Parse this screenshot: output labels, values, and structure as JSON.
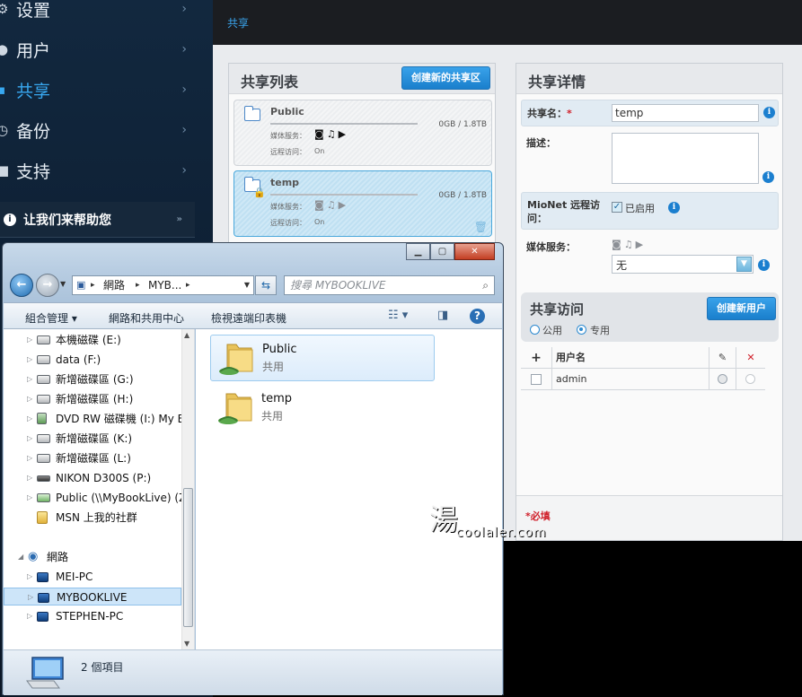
{
  "nav": {
    "items": [
      {
        "label": "设置",
        "icon": "gear-icon",
        "glyph": "⚙"
      },
      {
        "label": "用户",
        "icon": "user-icon",
        "glyph": "●"
      },
      {
        "label": "共享",
        "icon": "share-icon",
        "glyph": "▪"
      },
      {
        "label": "备份",
        "icon": "clock-icon",
        "glyph": "◷"
      },
      {
        "label": "支持",
        "icon": "support-icon",
        "glyph": "■"
      }
    ],
    "active_index": 2,
    "help": {
      "label": "让我们来帮助您",
      "more": "»"
    }
  },
  "breadcrumb": {
    "label": "共享"
  },
  "share_list": {
    "title": "共享列表",
    "create_button": "创建新的共享区",
    "media_label": "媒体服务：",
    "remote_label": "远程访问：",
    "items": [
      {
        "name": "Public",
        "size": "0GB / 1.8TB",
        "remote": "On",
        "selected": false,
        "locked": false
      },
      {
        "name": "temp",
        "size": "0GB / 1.8TB",
        "remote": "On",
        "selected": true,
        "locked": true
      }
    ]
  },
  "share_detail": {
    "title": "共享详情",
    "name_label": "共享名：",
    "required_mark": "*",
    "name_value": "temp",
    "desc_label": "描述：",
    "desc_value": "",
    "remote_label": "MioNet 远程访问：",
    "remote_enabled_label": "已启用",
    "remote_enabled": true,
    "media_label": "媒体服务：",
    "media_value": "无",
    "access": {
      "title": "共享访问",
      "create_user_button": "创建新用户",
      "options": [
        {
          "label": "公用",
          "selected": false
        },
        {
          "label": "专用",
          "selected": true
        }
      ]
    },
    "user_table": {
      "add_glyph": "+",
      "col_user": "用户名",
      "col_edit_glyph": "✎",
      "col_deny_glyph": "✕",
      "rows": [
        {
          "user": "admin"
        }
      ]
    },
    "required_note": "*必填"
  },
  "explorer": {
    "address_segments": [
      "網路",
      "MYB..."
    ],
    "search_placeholder": "搜尋 MYBOOKLIVE",
    "commands": {
      "organize": "組合管理",
      "network_center": "網路和共用中心",
      "printers": "檢視遠端印表機"
    },
    "tree": [
      {
        "label": "本機磁碟 (E:)",
        "icon": "drive-icon"
      },
      {
        "label": "data (F:)",
        "icon": "drive-icon"
      },
      {
        "label": "新增磁碟區 (G:)",
        "icon": "drive-icon"
      },
      {
        "label": "新增磁碟區 (H:)",
        "icon": "drive-icon"
      },
      {
        "label": "DVD RW 磁碟機 (I:) My Bo",
        "icon": "dvd-icon"
      },
      {
        "label": "新增磁碟區 (K:)",
        "icon": "drive-icon"
      },
      {
        "label": "新增磁碟區 (L:)",
        "icon": "drive-icon"
      },
      {
        "label": "NIKON D300S (P:)",
        "icon": "camera-drive-icon"
      },
      {
        "label": "Public (\\\\MyBookLive) (Z",
        "icon": "network-drive-icon"
      },
      {
        "label": "MSN 上我的社群",
        "icon": "folder-icon"
      }
    ],
    "network": {
      "label": "網路",
      "children": [
        {
          "label": "MEI-PC",
          "selected": false
        },
        {
          "label": "MYBOOKLIVE",
          "selected": true
        },
        {
          "label": "STEPHEN-PC",
          "selected": false
        }
      ]
    },
    "files": [
      {
        "name": "Public",
        "sub": "共用",
        "selected": true
      },
      {
        "name": "temp",
        "sub": "共用",
        "selected": false
      }
    ],
    "status": "2 個項目"
  },
  "watermark": "coolaler.com",
  "colors": {
    "accent": "#38a8f0",
    "button_blue": "#1a7fcc",
    "required_red": "#d0202a"
  }
}
